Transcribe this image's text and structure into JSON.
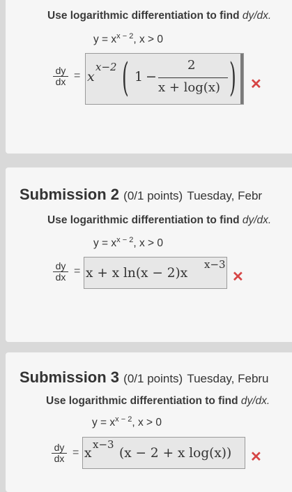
{
  "instruction": {
    "prefix": "Use logarithmic differentiation to find ",
    "target": "dy/dx."
  },
  "equation": {
    "lhs": "y = x",
    "exp": "x − 2",
    "cond": ",   x > 0"
  },
  "dydx": {
    "num": "dy",
    "den": "dx",
    "eq": "="
  },
  "submissions": [
    {
      "answer": {
        "base": "x",
        "exp": "x−2",
        "paren_open": "(",
        "one": "1",
        "minus": "−",
        "frac_num": "2",
        "frac_den": "x + log(x)",
        "paren_close": ")"
      },
      "mark": "✕"
    },
    {
      "title": "Submission 2",
      "points": "(0/1 points)",
      "date": "Tuesday, Febr",
      "answer": {
        "text": "x + x ln(x − 2)x",
        "exp": "x−3"
      },
      "mark": "✕"
    },
    {
      "title": "Submission 3",
      "points": "(0/1 points)",
      "date": "Tuesday, Febru",
      "answer": {
        "base": "x",
        "exp": "x−3",
        "rest": "(x − 2 + x log(x))"
      },
      "mark": "✕"
    }
  ]
}
